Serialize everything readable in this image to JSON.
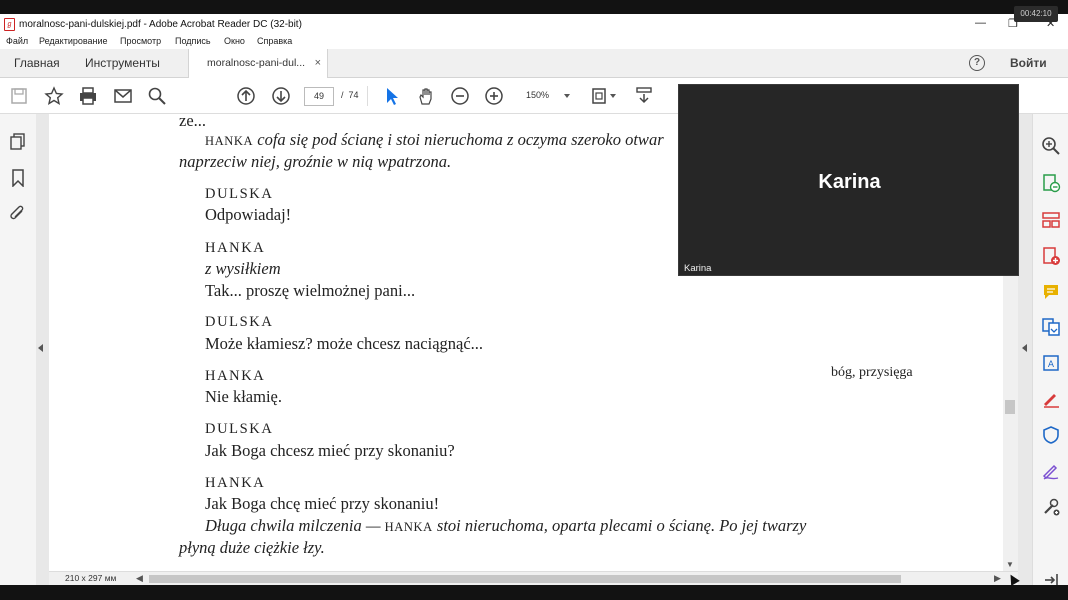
{
  "titlebar": {
    "title": "moralnosc-pani-dulskiej.pdf - Adobe Acrobat Reader DC (32-bit)",
    "minimize": "—",
    "restore": "❐",
    "close": "✕"
  },
  "clock": "00:42:10",
  "menu": [
    "Файл",
    "Редактирование",
    "Просмотр",
    "Подпись",
    "Окно",
    "Справка"
  ],
  "tabs": {
    "home": "Главная",
    "tools": "Инструменты",
    "document": "moralnosc-pani-dul...",
    "close": "×"
  },
  "account": {
    "help": "?",
    "login": "Войти"
  },
  "toolbar": {
    "icons": [
      "save-icon",
      "star-icon",
      "print-icon",
      "mail-icon",
      "search-icon",
      "page-up-icon",
      "page-down-icon",
      "select-cursor-icon",
      "hand-icon",
      "zoom-out-icon",
      "zoom-in-icon",
      "fit-page-icon",
      "scroll-mode-icon"
    ],
    "page_current": "49",
    "page_separator": "/",
    "page_total": "74",
    "zoom": "150%"
  },
  "document": {
    "top_fragment": "ze...",
    "stage1_name": "HANKA",
    "stage1_text": " cofa się pod ścianę i stoi nieruchoma z oczyma szeroko otwar",
    "stage1_line2": "naprzeciw niej, groźnie w nią wpatrzona.",
    "dialogue": [
      {
        "speaker": "DULSKA",
        "direction": "",
        "line": "Odpowiadaj!"
      },
      {
        "speaker": "HANKA",
        "direction": "z wysiłkiem",
        "line": "Tak... proszę wielmożnej pani..."
      },
      {
        "speaker": "DULSKA",
        "direction": "",
        "line": "Może kłamiesz? może chcesz naciągnąć..."
      },
      {
        "speaker": "HANKA",
        "direction": "",
        "line": "Nie kłamię."
      },
      {
        "speaker": "DULSKA",
        "direction": "",
        "line": "Jak Boga chcesz mieć przy skonaniu?"
      },
      {
        "speaker": "HANKA",
        "direction": "",
        "line": "Jak Boga chcę mieć przy skonaniu!"
      }
    ],
    "final_stage_a": "Długa chwila milczenia — ",
    "final_stage_name": "HANKA",
    "final_stage_b": " stoi nieruchoma, oparta plecami o ścianę. Po jej twarzy",
    "final_stage_line2": "płyną duże ciężkie łzy.",
    "margin_note": "bóg, przysięga"
  },
  "statusbar": {
    "page_size": "210 x 297 мм"
  },
  "video": {
    "name": "Karina",
    "label": "Karina"
  },
  "right_tools": [
    "zoom-tool-icon",
    "export-pdf-icon",
    "organize-pages-icon",
    "create-pdf-icon",
    "comment-icon",
    "combine-files-icon",
    "edit-pdf-icon",
    "fill-sign-icon",
    "protect-icon",
    "sign-icon",
    "more-tools-icon",
    "collapse-panel-icon"
  ],
  "colors": {
    "accent_blue": "#1473e6",
    "comment_yellow": "#e8b100",
    "export_red": "#d83b3b",
    "sign_purple": "#7b4fd1"
  }
}
